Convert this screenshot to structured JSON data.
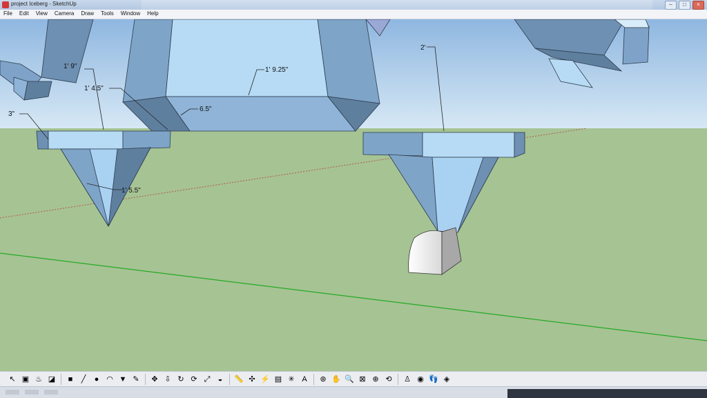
{
  "window": {
    "title": "project Iceberg - SketchUp",
    "controls": [
      "–",
      "□",
      "×"
    ]
  },
  "menu": [
    "File",
    "Edit",
    "View",
    "Camera",
    "Draw",
    "Tools",
    "Window",
    "Help"
  ],
  "dimensions": {
    "d1": "1' 9\"",
    "d2": "1' 4.5\"",
    "d3": "3\"",
    "d4": "1' 9.25\"",
    "d5": "6.5\"",
    "d6": "2'",
    "d7": "1' 5.5\""
  },
  "colors": {
    "sky_top": "#8fb7e0",
    "sky_bottom": "#d6e8f5",
    "ground": "#a6c394",
    "face_light": "#a9d1f2",
    "face_mid": "#7ea4c8",
    "face_dark": "#5f7f9f",
    "green_axis": "#22aa22",
    "red_axis": "#b05a4a"
  },
  "toolbar": [
    {
      "name": "select-tool-icon",
      "glyph": "↖"
    },
    {
      "name": "make-component-icon",
      "glyph": "▣"
    },
    {
      "name": "paint-bucket-icon",
      "glyph": "♨"
    },
    {
      "name": "eraser-icon",
      "glyph": "◪"
    },
    {
      "sep": true
    },
    {
      "name": "rectangle-tool-icon",
      "glyph": "■"
    },
    {
      "name": "line-tool-icon",
      "glyph": "╱"
    },
    {
      "name": "circle-tool-icon",
      "glyph": "●"
    },
    {
      "name": "arc-tool-icon",
      "glyph": "◠"
    },
    {
      "name": "polygon-tool-icon",
      "glyph": "▼"
    },
    {
      "name": "freehand-tool-icon",
      "glyph": "✎"
    },
    {
      "sep": true
    },
    {
      "name": "move-tool-icon",
      "glyph": "✥"
    },
    {
      "name": "push-pull-icon",
      "glyph": "⇩"
    },
    {
      "name": "rotate-tool-icon",
      "glyph": "↻"
    },
    {
      "name": "follow-me-icon",
      "glyph": "⟳"
    },
    {
      "name": "scale-tool-icon",
      "glyph": "⤢"
    },
    {
      "name": "offset-tool-icon",
      "glyph": "◒"
    },
    {
      "sep": true
    },
    {
      "name": "tape-measure-icon",
      "glyph": "📏"
    },
    {
      "name": "dimension-tool-icon",
      "glyph": "✣"
    },
    {
      "name": "protractor-icon",
      "glyph": "⚡"
    },
    {
      "name": "text-tool-icon",
      "glyph": "▤"
    },
    {
      "name": "axes-tool-icon",
      "glyph": "✳"
    },
    {
      "name": "3d-text-icon",
      "glyph": "A"
    },
    {
      "sep": true
    },
    {
      "name": "orbit-tool-icon",
      "glyph": "⊛"
    },
    {
      "name": "pan-tool-icon",
      "glyph": "✋"
    },
    {
      "name": "zoom-tool-icon",
      "glyph": "🔍"
    },
    {
      "name": "zoom-window-icon",
      "glyph": "⊠"
    },
    {
      "name": "zoom-extents-icon",
      "glyph": "⊕"
    },
    {
      "name": "previous-view-icon",
      "glyph": "⟲"
    },
    {
      "sep": true
    },
    {
      "name": "position-camera-icon",
      "glyph": "♙"
    },
    {
      "name": "look-around-icon",
      "glyph": "◉"
    },
    {
      "name": "walk-tool-icon",
      "glyph": "👣"
    },
    {
      "name": "section-plane-icon",
      "glyph": "◈"
    }
  ]
}
